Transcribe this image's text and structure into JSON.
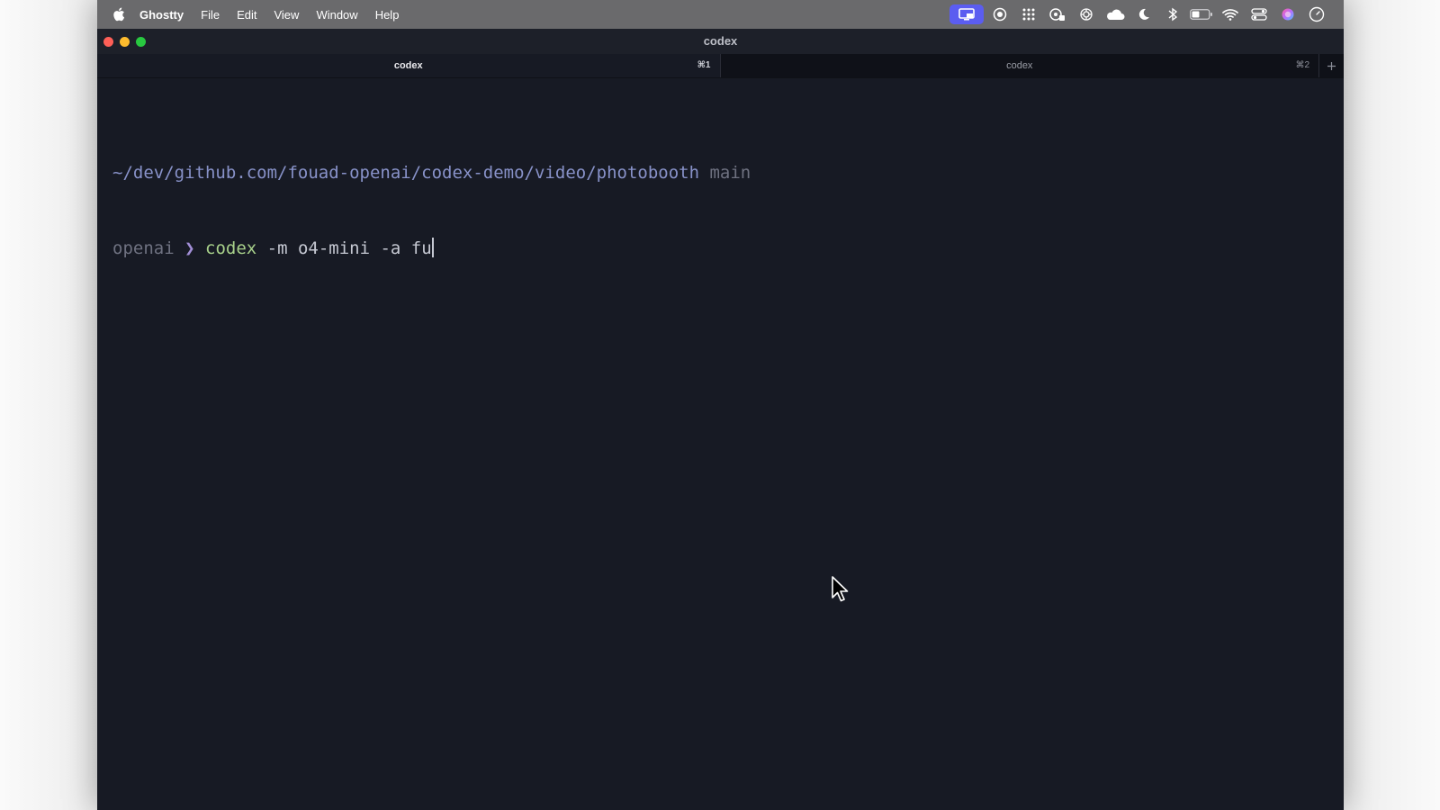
{
  "menubar": {
    "app_name": "Ghostty",
    "items": [
      "File",
      "Edit",
      "View",
      "Window",
      "Help"
    ],
    "status_icons": [
      "screen-share-icon",
      "record-icon",
      "app-grid-icon",
      "accessibility-icon",
      "chatgpt-icon",
      "cloud-icon",
      "moon-icon",
      "bluetooth-icon",
      "battery-icon",
      "wifi-icon",
      "control-center-icon",
      "siri-icon",
      "clock-icon"
    ]
  },
  "window": {
    "title": "codex"
  },
  "tabs": [
    {
      "label": "codex",
      "shortcut": "⌘1",
      "active": true
    },
    {
      "label": "codex",
      "shortcut": "⌘2",
      "active": false
    }
  ],
  "terminal": {
    "path": "~/dev/github.com/fouad-openai/codex-demo/video/photobooth",
    "branch": "main",
    "host": "openai",
    "prompt_symbol": "❯",
    "command": "codex",
    "args": "-m o4-mini -a fu"
  },
  "colors": {
    "background": "#171a24",
    "path": "#8892c9",
    "prompt_arrow": "#a38fd8",
    "command": "#a7d08a",
    "active_status": "#5b5df0"
  }
}
